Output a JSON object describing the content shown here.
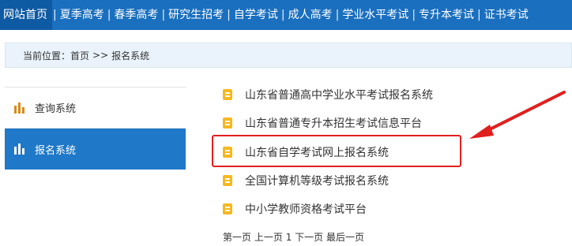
{
  "topnav": {
    "items": [
      "网站首页",
      "夏季高考",
      "春季高考",
      "研究生招考",
      "自学考试",
      "成人高考",
      "学业水平考试",
      "专升本考试",
      "证书考试"
    ],
    "separator": "|"
  },
  "breadcrumb": {
    "prefix": "当前位置：",
    "home": "首页",
    "sep": ">>",
    "current": "报名系统"
  },
  "sidebar": {
    "items": [
      {
        "label": "查询系统",
        "icon": "bar-chart-icon"
      },
      {
        "label": "报名系统",
        "icon": "bar-chart-icon"
      }
    ]
  },
  "links": [
    "山东省普通高中学业水平考试报名系统",
    "山东省普通专升本招生考试信息平台",
    "山东省自学考试网上报名系统",
    "全国计算机等级考试报名系统",
    "中小学教师资格考试平台"
  ],
  "pager": {
    "first": "第一页",
    "prev": "上一页",
    "page": "1",
    "next": "下一页",
    "last": "最后一页"
  },
  "colors": {
    "nav_bg": "#1a6fbf",
    "sidebar_active": "#1f78c8",
    "doc_icon": "#f5b820",
    "annotation_red": "#e0201e"
  }
}
